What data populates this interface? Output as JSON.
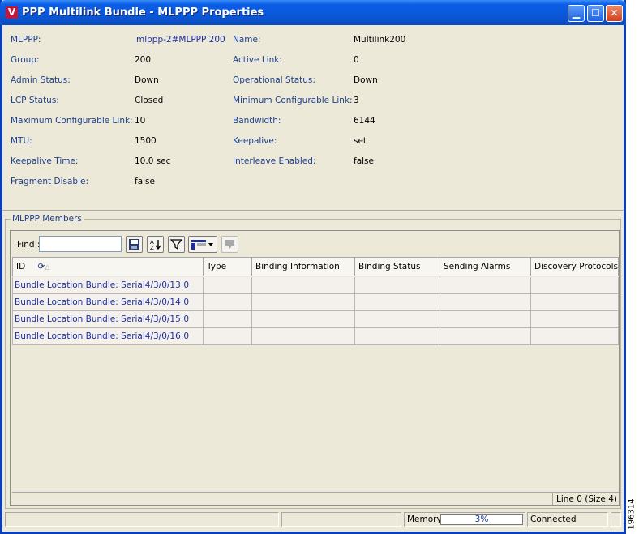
{
  "window": {
    "title": "PPP Multilink Bundle - MLPPP Properties",
    "icon_letter": "V",
    "controls": [
      "minimize-icon",
      "maximize-icon",
      "close-icon"
    ]
  },
  "properties": {
    "left": [
      {
        "label": "MLPPP:",
        "value": "mlppp-2#MLPPP 200"
      },
      {
        "label": "Group:",
        "value": "200"
      },
      {
        "label": "Admin Status:",
        "value": "Down"
      },
      {
        "label": "LCP Status:",
        "value": "Closed"
      },
      {
        "label": "Maximum Configurable Link:",
        "value": "10"
      },
      {
        "label": "MTU:",
        "value": "1500"
      },
      {
        "label": "Keepalive Time:",
        "value": "10.0 sec"
      },
      {
        "label": "Fragment Disable:",
        "value": "false"
      }
    ],
    "right": [
      {
        "label": "Name:",
        "value": "Multilink200"
      },
      {
        "label": "Active Link:",
        "value": "0"
      },
      {
        "label": "Operational Status:",
        "value": "Down"
      },
      {
        "label": "Minimum Configurable Link:",
        "value": "3"
      },
      {
        "label": "Bandwidth:",
        "value": "6144"
      },
      {
        "label": "Keepalive:",
        "value": "set"
      },
      {
        "label": "Interleave Enabled:",
        "value": "false"
      }
    ]
  },
  "members": {
    "legend": "MLPPP Members",
    "find_label": "Find :",
    "find_value": "",
    "toolbar_icons": [
      "save-icon",
      "sort-az-icon",
      "filter-icon",
      "columns-icon",
      "export-icon"
    ],
    "columns": [
      "ID",
      "Type",
      "Binding Information",
      "Binding Status",
      "Sending Alarms",
      "Discovery Protocols"
    ],
    "rows": [
      [
        "Bundle Location Bundle: Serial4/3/0/13:0",
        "",
        "",
        "",
        "",
        ""
      ],
      [
        "Bundle Location Bundle: Serial4/3/0/14:0",
        "",
        "",
        "",
        "",
        ""
      ],
      [
        "Bundle Location Bundle: Serial4/3/0/15:0",
        "",
        "",
        "",
        "",
        ""
      ],
      [
        "Bundle Location Bundle: Serial4/3/0/16:0",
        "",
        "",
        "",
        "",
        ""
      ]
    ],
    "line_info": "Line 0 (Size 4)"
  },
  "statusbar": {
    "memory_label": "Memory:",
    "memory_value": "3%",
    "connection": "Connected"
  },
  "figure_id": "196314"
}
